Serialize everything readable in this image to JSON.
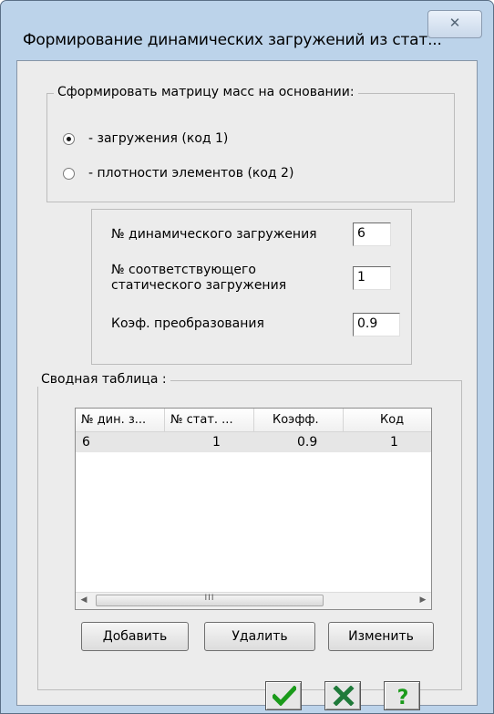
{
  "window": {
    "title": "Формирование динамических загружений из стат...",
    "close_glyph": "✕"
  },
  "mass_group": {
    "legend": "Сформировать матрицу масс на основании:",
    "options": [
      {
        "label": "- загружения (код 1)",
        "selected": true
      },
      {
        "label": "- плотности элементов (код 2)",
        "selected": false
      }
    ]
  },
  "params": {
    "dyn_load_label": "№ динамического загружения",
    "dyn_load_value": "6",
    "static_load_label_line1": "№ соответствующего",
    "static_load_label_line2": "статического загружения",
    "static_load_value": "1",
    "coef_label": "Коэф. преобразования",
    "coef_value": "0.9"
  },
  "summary": {
    "legend": "Сводная таблица :",
    "columns": [
      "№ дин. з...",
      "№ стат. ...",
      "Коэфф.",
      "Код"
    ],
    "rows": [
      [
        "6",
        "1",
        "0.9",
        "1"
      ]
    ],
    "scroll_left": "◀",
    "scroll_right": "▶",
    "scroll_grip": "III"
  },
  "buttons": {
    "add": "Добавить",
    "delete": "Удалить",
    "edit": "Изменить"
  },
  "dialog_buttons": {
    "ok_icon": "check-icon",
    "cancel_icon": "x-icon",
    "help_icon": "question-icon",
    "ok_color": "#1a9a1a",
    "cancel_color": "#1f7a3a",
    "help_color": "#1a9a1a"
  }
}
